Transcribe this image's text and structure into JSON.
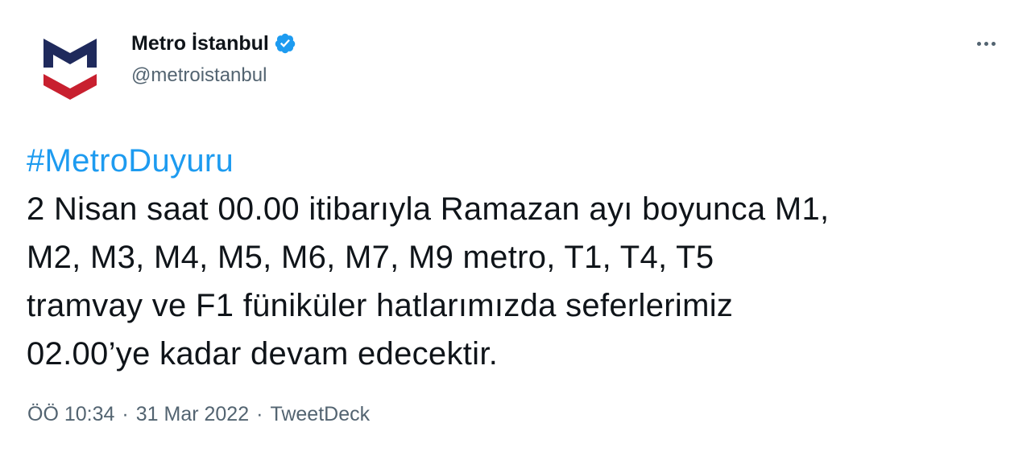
{
  "author": {
    "display_name": "Metro İstanbul",
    "handle": "@metroistanbul",
    "verified": true,
    "avatar_icon": "metro-istanbul-logo"
  },
  "tweet": {
    "hashtag": "#MetroDuyuru",
    "lines": [
      "2 Nisan saat 00.00 itibarıyla Ramazan ayı boyunca M1,",
      "M2, M3, M4, M5, M6, M7, M9 metro, T1, T4, T5",
      "tramvay ve F1 füniküler hatlarımızda seferlerimiz",
      "02.00’ye kadar devam edecektir."
    ],
    "time": "ÖÖ 10:34",
    "separator": "·",
    "date": "31 Mar 2022",
    "source": "TweetDeck"
  },
  "colors": {
    "link": "#1d9bf0",
    "secondary_text": "#536471",
    "primary_text": "#0f1419",
    "logo_navy": "#1f2a5c",
    "logo_red": "#c8202f",
    "verified_badge": "#1d9bf0"
  },
  "icons": {
    "more": "more-horizontal-icon",
    "verified": "verified-badge-icon"
  }
}
